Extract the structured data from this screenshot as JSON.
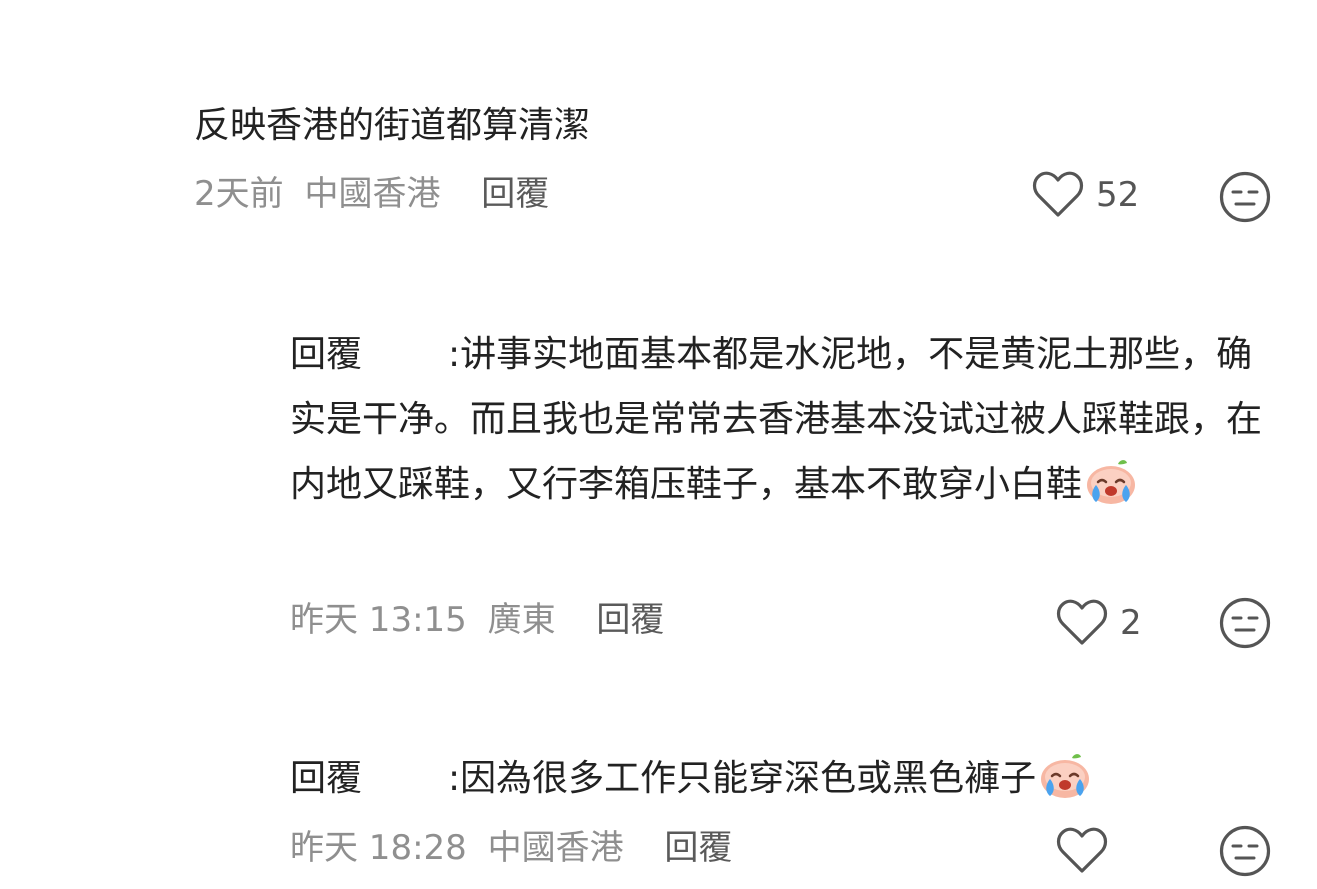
{
  "comment": {
    "text": "反映香港的街道都算清潔",
    "time": "2天前",
    "location": "中國香港",
    "reply_label": "回覆",
    "like_count": "52"
  },
  "replies": [
    {
      "author": "回覆",
      "separator": ":",
      "text": "讲事实地面基本都是水泥地，不是黄泥土那些，确实是干净。而且我也是常常去香港基本没试过被人踩鞋跟，在内地又踩鞋，又行李箱压鞋子，基本不敢穿小白鞋",
      "emoji": "crying-face-emoji",
      "time": "昨天 13:15",
      "location": "廣東",
      "reply_label": "回覆",
      "like_count": "2"
    },
    {
      "author": "回覆",
      "separator": ":",
      "text": "因為很多工作只能穿深色或黑色褲子",
      "emoji": "crying-face-emoji",
      "time": "昨天 18:28",
      "location": "中國香港",
      "reply_label": "回覆",
      "like_count": ""
    }
  ],
  "icons": {
    "like": "heart-outline-icon",
    "dislike": "neutral-face-icon"
  }
}
